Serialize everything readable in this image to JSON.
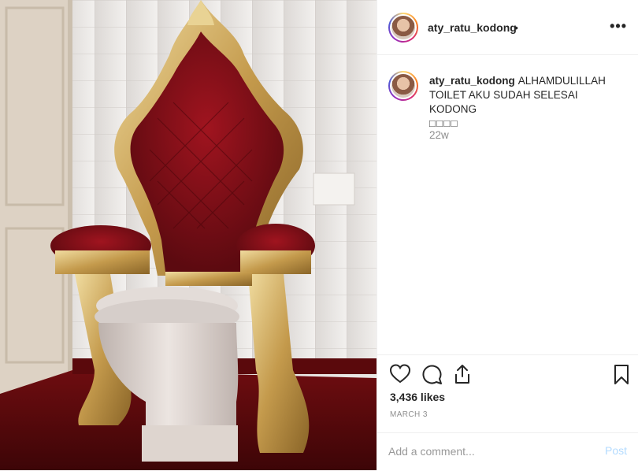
{
  "post": {
    "image_description_icon": "throne-toilet-photo",
    "header": {
      "username": "aty_ratu_kodong",
      "separator": "•",
      "more_icon": "more-options-icon",
      "more_label": "•••"
    },
    "caption": {
      "username": "aty_ratu_kodong",
      "text": "ALHAMDULILLAH TOILET AKU SUDAH SELESAI KODONG",
      "emoji_placeholders": "□□□□",
      "time_ago": "22w"
    },
    "actions": {
      "like_icon": "heart-icon",
      "comment_icon": "comment-bubble-icon",
      "share_icon": "share-icon",
      "save_icon": "bookmark-icon",
      "likes": "3,436 likes",
      "date": "MARCH 3"
    },
    "comment_box": {
      "placeholder": "Add a comment...",
      "post_label": "Post"
    }
  }
}
